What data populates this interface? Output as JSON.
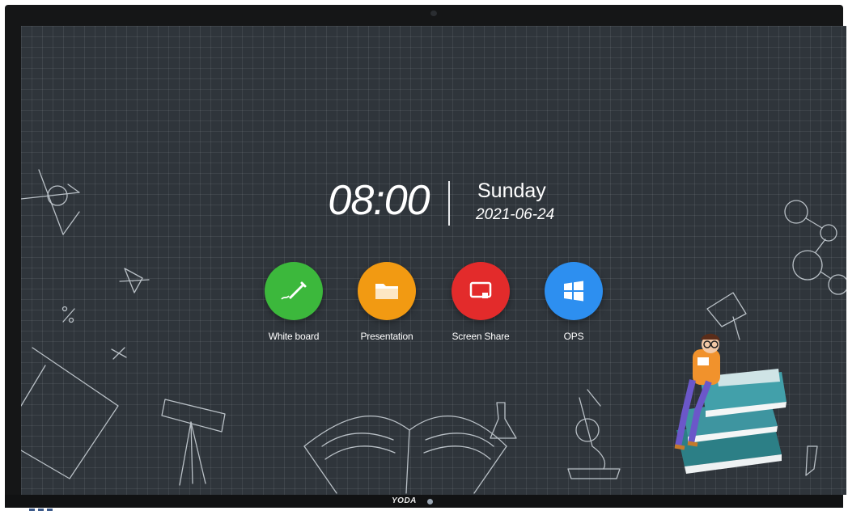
{
  "clock": {
    "time": "08:00",
    "day": "Sunday",
    "date": "2021-06-24"
  },
  "apps": [
    {
      "label": "White board",
      "icon": "pen-icon",
      "color": "#3cb83c"
    },
    {
      "label": "Presentation",
      "icon": "folder-icon",
      "color": "#f29a12"
    },
    {
      "label": "Screen Share",
      "icon": "screen-share-icon",
      "color": "#e32b2b"
    },
    {
      "label": "OPS",
      "icon": "windows-icon",
      "color": "#2d8ff0"
    }
  ],
  "bezel": {
    "brand": "YODA"
  },
  "colors": {
    "background": "#2f353b",
    "bezel": "#151617"
  }
}
